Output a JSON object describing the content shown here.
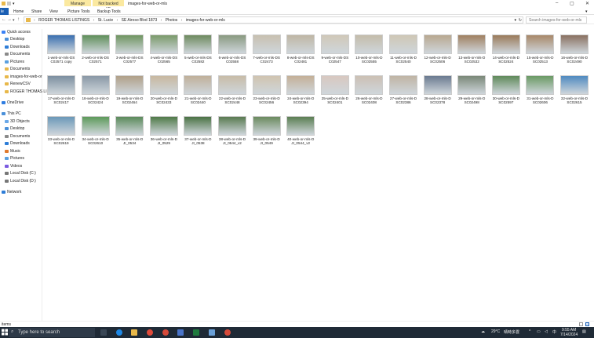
{
  "titlebar": {
    "manage_tab": "Manage",
    "backup_tab": "Not backed up",
    "window_title": "images-for-web-or-mls"
  },
  "ribbon": {
    "file": "le",
    "tabs": [
      "Home",
      "Share",
      "View",
      "Picture Tools",
      "Backup Tools"
    ]
  },
  "address": {
    "crumbs": [
      "ROGER THOMAS LISTINGS",
      "St. Lucie",
      "SE Airoso Blvd 1873",
      "Photos",
      "images-for-web-or-mls"
    ],
    "search_placeholder": "Search images-for-web-or-mls"
  },
  "navpane": {
    "items": [
      {
        "label": "Quick access",
        "color": "#3b82f6"
      },
      {
        "label": "Desktop",
        "color": "#4a90d9"
      },
      {
        "label": "Downloads",
        "color": "#2e7dd7"
      },
      {
        "label": "Documents",
        "color": "#8a8a8a"
      },
      {
        "label": "Pictures",
        "color": "#5aa0e0"
      },
      {
        "label": "Documents",
        "color": "#e8b84a"
      },
      {
        "label": "images-for-web-or",
        "color": "#e8b84a"
      },
      {
        "label": "RenewCSV",
        "color": "#e8b84a"
      },
      {
        "label": "ROGER THOMAS LI",
        "color": "#e8b84a"
      },
      {
        "label": "OneDrive",
        "color": "#2f7de1"
      },
      {
        "label": "This PC",
        "color": "#4a90d9"
      },
      {
        "label": "3D Objects",
        "color": "#6aa8e8"
      },
      {
        "label": "Desktop",
        "color": "#4a90d9"
      },
      {
        "label": "Documents",
        "color": "#8a8a8a"
      },
      {
        "label": "Downloads",
        "color": "#2e7dd7"
      },
      {
        "label": "Music",
        "color": "#e07a2e"
      },
      {
        "label": "Pictures",
        "color": "#5aa0e0"
      },
      {
        "label": "Videos",
        "color": "#7a5ae0"
      },
      {
        "label": "Local Disk (C:)",
        "color": "#777777"
      },
      {
        "label": "Local Disk (D:)",
        "color": "#777777"
      },
      {
        "label": "Network",
        "color": "#2e7dd7"
      }
    ]
  },
  "files": [
    {
      "name": "1-web-or-mls-DS C02571 copy",
      "color": "#3a6fb0"
    },
    {
      "name": "2-web-or-mls-DS C02571",
      "color": "#5f8f5a"
    },
    {
      "name": "3-web-or-mls-DS C02577",
      "color": "#6f9560"
    },
    {
      "name": "4-web-or-mls-DS C02565",
      "color": "#7a9a6a"
    },
    {
      "name": "5-web-or-mls-DS C02582",
      "color": "#6d8a5e"
    },
    {
      "name": "6-web-or-mls-DS C02558",
      "color": "#8a9a80"
    },
    {
      "name": "7-web-or-mls-DS C02473",
      "color": "#c8c0b0"
    },
    {
      "name": "8-web-or-mls-DS C02481",
      "color": "#bfb6a4"
    },
    {
      "name": "9-web-or-mls-DS C02547",
      "color": "#d0c8b8"
    },
    {
      "name": "10-web-or-mls-D SC02555",
      "color": "#c4bcaa"
    },
    {
      "name": "11-web-or-mls-D SC02540",
      "color": "#cfc7b5"
    },
    {
      "name": "12-web-or-mls-D SC02506",
      "color": "#b8a890"
    },
    {
      "name": "13-web-or-mls-D SC02532",
      "color": "#a08060"
    },
    {
      "name": "14-web-or-mls-D SC02524",
      "color": "#9a7a5a"
    },
    {
      "name": "15-web-or-mls-D SC02513",
      "color": "#a88868"
    },
    {
      "name": "16-web-or-mls-D SC02490",
      "color": "#8a7060"
    },
    {
      "name": "17-web-or-mls-D SC02417",
      "color": "#7c8fa0"
    },
    {
      "name": "18-web-or-mls-D SC02424",
      "color": "#8a98a6"
    },
    {
      "name": "19-web-or-mls-D SC02464",
      "color": "#b0a088"
    },
    {
      "name": "20-web-or-mls-D SC02433",
      "color": "#c8b8a0"
    },
    {
      "name": "21-web-or-mls-D SC02440",
      "color": "#c0b09a"
    },
    {
      "name": "22-web-or-mls-D SC02448",
      "color": "#c8bca8"
    },
    {
      "name": "23-web-or-mls-D SC02456",
      "color": "#d0c4b0"
    },
    {
      "name": "24-web-or-mls-D SC02394",
      "color": "#c4b098"
    },
    {
      "name": "25-web-or-mls-D SC02401",
      "color": "#d8c8c0"
    },
    {
      "name": "26-web-or-mls-D SC02408",
      "color": "#ccc0b4"
    },
    {
      "name": "27-web-or-mls-D SC02386",
      "color": "#c0b4a4"
    },
    {
      "name": "28-web-or-mls-D SC02378",
      "color": "#6a7a90"
    },
    {
      "name": "29-web-or-mls-D SC02498",
      "color": "#7a8878"
    },
    {
      "name": "30-web-or-mls-D SC02597",
      "color": "#5f8a5a"
    },
    {
      "name": "31-web-or-mls-D SC02606",
      "color": "#6a9a64"
    },
    {
      "name": "32-web-or-mls-D SC02615",
      "color": "#4f8ac0"
    },
    {
      "name": "33-web-or-mls-D SC02619",
      "color": "#6a98b8"
    },
    {
      "name": "34-web-or-mls-D SC02610",
      "color": "#5c9a5a"
    },
    {
      "name": "35-web-or-mls-D JI_0534",
      "color": "#5a8a5a"
    },
    {
      "name": "36-web-or-mls-D JI_0529",
      "color": "#4f7a48"
    },
    {
      "name": "37-web-or-mls-D JI_0538",
      "color": "#4a7244"
    },
    {
      "name": "38-web-or-mls-D JI_0544_v2",
      "color": "#587a50"
    },
    {
      "name": "39-web-or-mls-D JI_0549",
      "color": "#6a8a5e"
    },
    {
      "name": "40-web-or-mls-D JI_0544_v2",
      "color": "#5a7e52"
    }
  ],
  "status": {
    "text": "items"
  },
  "taskbar": {
    "search_placeholder": "Type here to search",
    "weather": "29°C",
    "lang": "晴時多雲",
    "time": "9:55 AM",
    "date": "7/14/2024"
  }
}
